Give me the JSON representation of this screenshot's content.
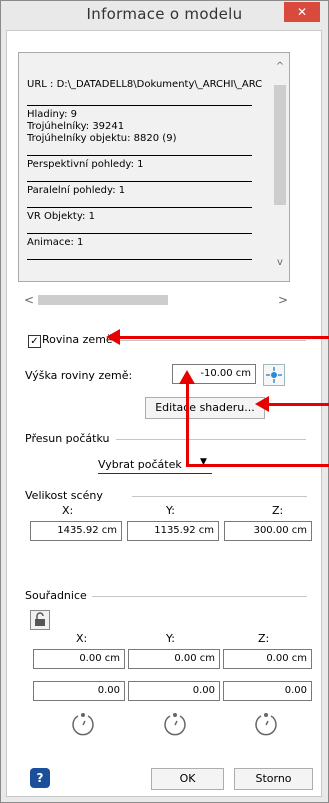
{
  "window": {
    "title": "Informace o modelu",
    "close_glyph": "✕"
  },
  "info": {
    "url": "URL : D:\\_DATADELL8\\Dokumenty\\_ARCHI\\_ARC",
    "levels": "Hladiny: 9",
    "triangles": "Trojúhelníky: 39241",
    "object_triangles": "Trojúhelníky objektu: 8820 (9)",
    "persp_views": "Perspektivní pohledy: 1",
    "parallel_views": "Paralelní pohledy: 1",
    "vr_objects": "VR Objekty: 1",
    "animations": "Animace: 1"
  },
  "ground": {
    "checkbox_label": "Rovina země",
    "checked": true,
    "height_label": "Výška roviny země:",
    "height_value": "-10.00 cm",
    "shader_button": "Editace shaderu..."
  },
  "origin": {
    "section": "Přesun počátku",
    "select_value": "Vybrat počátek"
  },
  "scene_size": {
    "section": "Velikost scény",
    "x_label": "X:",
    "y_label": "Y:",
    "z_label": "Z:",
    "x": "1435.92 cm",
    "y": "1135.92 cm",
    "z": "300.00 cm"
  },
  "coords": {
    "section": "Souřadnice",
    "x_label": "X:",
    "y_label": "Y:",
    "z_label": "Z:",
    "x": "0.00 cm",
    "y": "0.00 cm",
    "z": "0.00 cm",
    "rx": "0.00",
    "ry": "0.00",
    "rz": "0.00"
  },
  "footer": {
    "help_glyph": "?",
    "ok": "OK",
    "cancel": "Storno"
  },
  "colors": {
    "annotation_arrow": "#e60000",
    "close_button": "#d84b3c",
    "help_button": "#1b4f9c"
  }
}
